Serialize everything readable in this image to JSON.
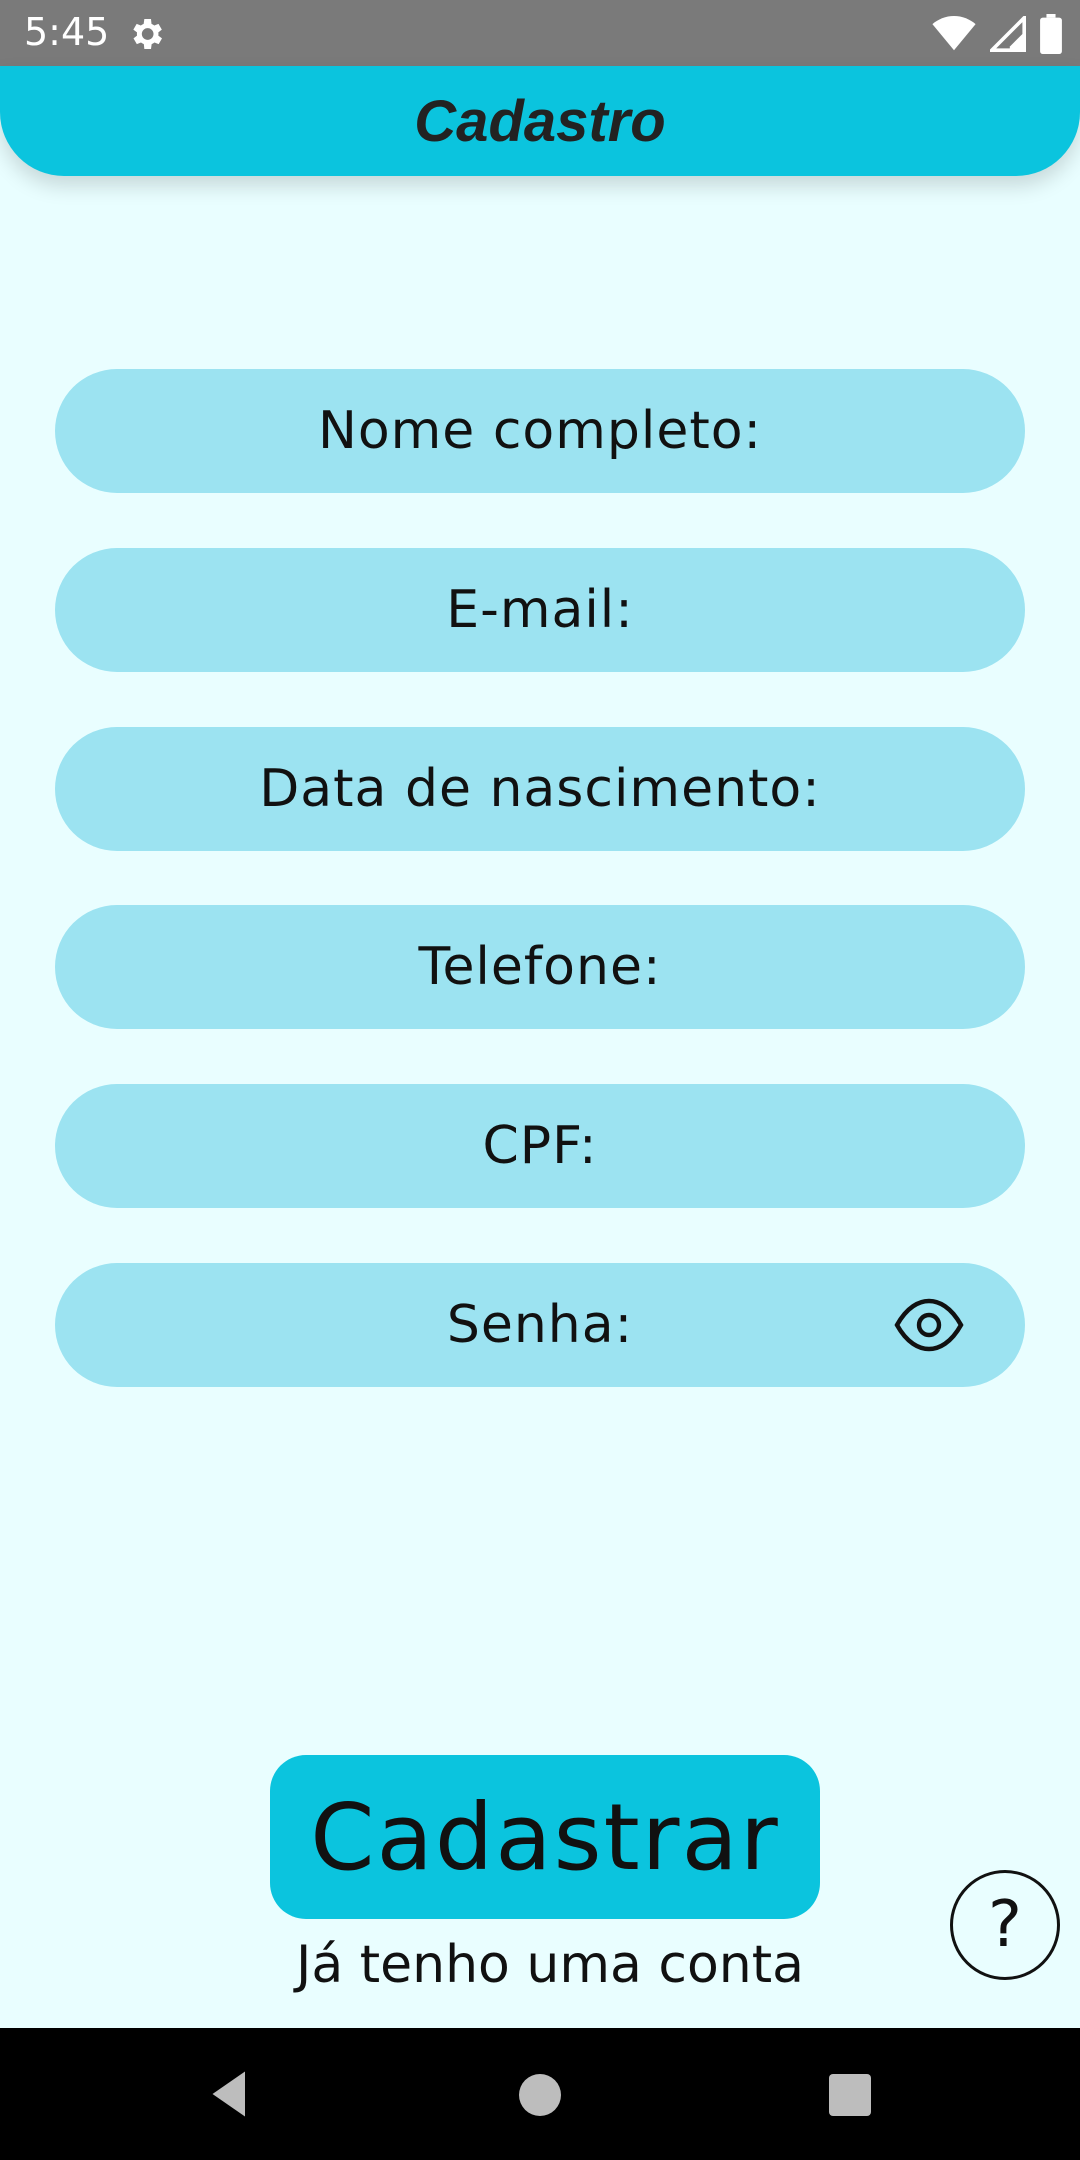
{
  "status_bar": {
    "time": "5:45",
    "icons": [
      "settings-gear-icon",
      "wifi-icon",
      "signal-icon",
      "battery-icon"
    ]
  },
  "header": {
    "title": "Cadastro",
    "color": "#0bc4de"
  },
  "form": {
    "fields": [
      {
        "label": "Nome completo:"
      },
      {
        "label": "E-mail:"
      },
      {
        "label": "Data de nascimento:"
      },
      {
        "label": "Telefone:"
      },
      {
        "label": "CPF:"
      },
      {
        "label": "Senha:",
        "icon": "eye-icon"
      }
    ],
    "field_color": "#9ce3f1"
  },
  "actions": {
    "submit_label": "Cadastrar",
    "login_link": "Já tenho uma conta",
    "help_glyph": "?"
  },
  "nav": {
    "icons": [
      "back-icon",
      "home-icon",
      "recents-icon"
    ]
  },
  "colors": {
    "background": "#e9feff",
    "accent": "#0bc4de"
  }
}
